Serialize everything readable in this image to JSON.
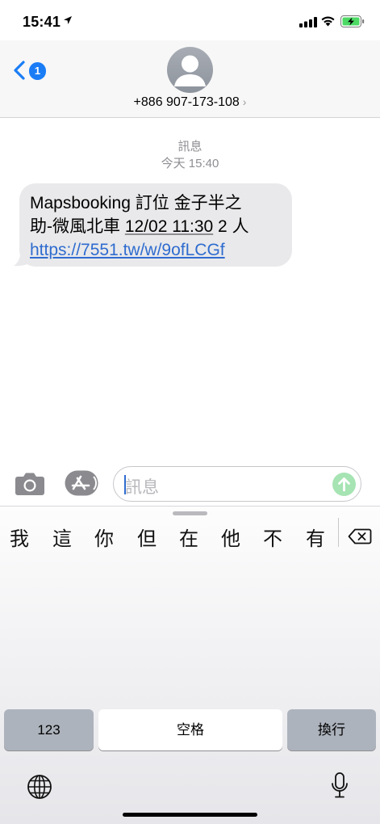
{
  "status_bar": {
    "time": "15:41",
    "icons": [
      "location-arrow-icon",
      "signal-icon",
      "wifi-icon",
      "battery-charging-icon"
    ],
    "battery_color": "#4cd964"
  },
  "header": {
    "back_badge": "1",
    "contact": "+886 907-173-108",
    "contact_chevron": "›",
    "accent_color": "#1a7df6"
  },
  "thread": {
    "service": "訊息",
    "timestamp": "今天 15:40",
    "message": {
      "line1": "Mapsbooking 訂位 金子半之",
      "line2_prefix": "助-微風北車 ",
      "line2_date": "12/02 11:30",
      "line2_suffix": " 2 人",
      "url": "https://7551.tw/w/9ofLCGf"
    },
    "link_color": "#2f6ccf"
  },
  "composer": {
    "placeholder": "訊息",
    "icons": [
      "camera-icon",
      "app-store-icon",
      "send-arrow-icon"
    ]
  },
  "keyboard": {
    "candidates": [
      "我",
      "這",
      "你",
      "但",
      "在",
      "他",
      "不",
      "有"
    ],
    "key_123": "123",
    "key_space": "空格",
    "key_return": "換行",
    "icons": [
      "delete-icon",
      "globe-icon",
      "microphone-icon"
    ]
  }
}
